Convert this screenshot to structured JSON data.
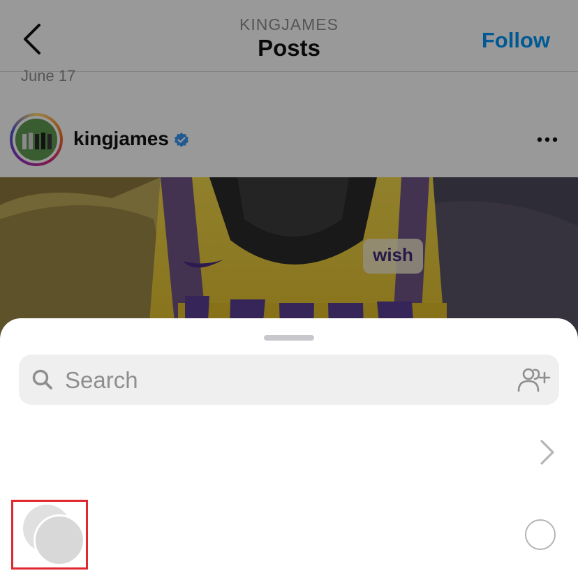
{
  "header": {
    "subtitle": "KINGJAMES",
    "title": "Posts",
    "follow_label": "Follow"
  },
  "feed": {
    "date_label": "June 17",
    "post": {
      "username": "kingjames",
      "verified": true,
      "more_icon": "more-horizontal-icon"
    }
  },
  "share_sheet": {
    "search": {
      "placeholder": "Search",
      "value": ""
    },
    "icons": {
      "search": "search-icon",
      "add_people": "add-people-icon",
      "chevron": "chevron-right-icon",
      "select": "radio-circle-icon"
    }
  },
  "colors": {
    "accent": "#0095f6",
    "highlight_box": "#e0282e",
    "sheet_bg": "#ffffff",
    "search_bg": "#efefef"
  }
}
